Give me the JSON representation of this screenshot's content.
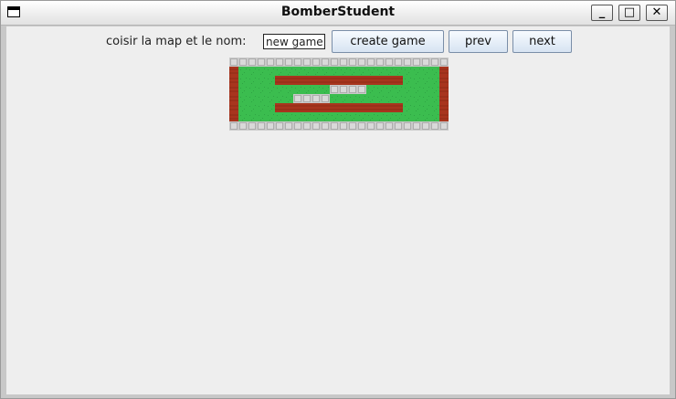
{
  "window": {
    "title": "BomberStudent"
  },
  "titlebar_buttons": {
    "minimize": "_",
    "maximize": "□",
    "close": "✕"
  },
  "toolbar": {
    "label": "coisir la map et le nom:",
    "name_value": "new game",
    "create_label": "create game",
    "prev_label": "prev",
    "next_label": "next"
  },
  "map": {
    "rows": [
      "SSSSSSSSSSSSSSSSSSSSSSSS",
      "BGGGGGGGGGGGGGGGGGGGGGGB",
      "BGGGGBBBBBBBBBBBBBBGGGGB",
      "BGGGGGGGGGGSSSSGGGGGGGGB",
      "BGGGGGGSSSSGGGGGGGGGGGGB",
      "BGGGGBBBBBBBBBBBBBBGGGGB",
      "BGGGGGGGGGGGGGGGGGGGGGGB",
      "SSSSSSSSSSSSSSSSSSSSSSSS"
    ],
    "legend": {
      "S": "stone",
      "B": "brick",
      "G": "grass"
    },
    "colors": {
      "grass": "#3bbd4f",
      "brick": "#a8351e",
      "stone": "#c9c9c9"
    }
  }
}
